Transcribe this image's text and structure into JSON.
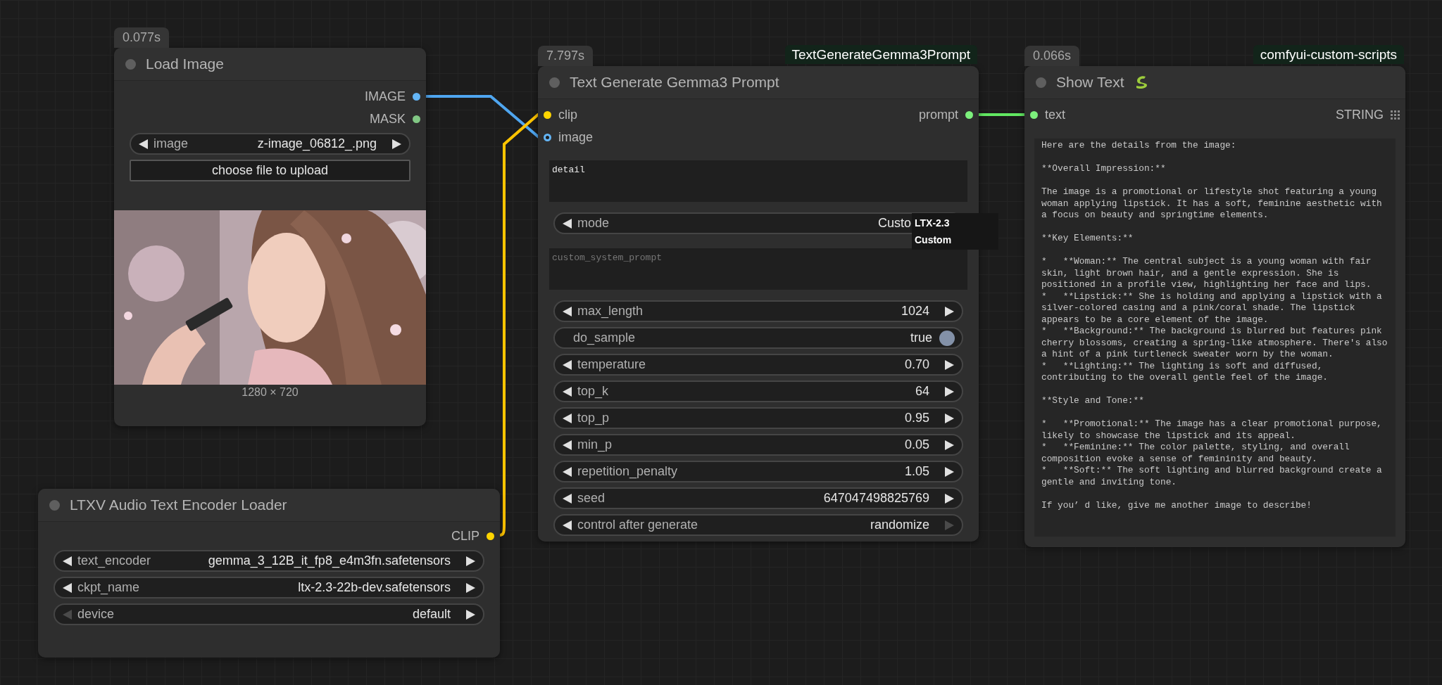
{
  "nodes": [
    {
      "title": "Load Image",
      "timing": "0.077s",
      "outputs": [
        {
          "label": "IMAGE",
          "kind": "dot",
          "color": "#64b5f6"
        },
        {
          "label": "MASK",
          "kind": "dot",
          "color": "#81c784"
        }
      ],
      "widgets": [
        {
          "kind": "combo",
          "label": "image",
          "value": "z-image_06812_.png",
          "prev_disabled": false,
          "next_disabled": false
        },
        {
          "kind": "button",
          "label": "choose file to upload"
        }
      ],
      "preview": {
        "kind": "picture",
        "caption": "1280 × 720"
      }
    },
    {
      "title": "Text Generate Gemma3 Prompt",
      "timing": "7.797s",
      "class_badge": "TextGenerateGemma3Prompt",
      "inputs": [
        {
          "label": "clip",
          "kind": "dot",
          "color": "#ffd500",
          "hollow": false
        },
        {
          "label": "image",
          "kind": "dot",
          "color": "#64b5f6",
          "hollow": true
        }
      ],
      "outputs": [
        {
          "label": "prompt",
          "kind": "dot",
          "color": "#7cf07c"
        }
      ],
      "widgets": [
        {
          "kind": "textarea",
          "value": "detail"
        },
        {
          "kind": "combo",
          "label": "mode",
          "value": "Custo",
          "prev_disabled": false,
          "menu": [
            "LTX-2.3",
            "Custom"
          ]
        },
        {
          "kind": "textarea",
          "placeholder": "custom_system_prompt"
        },
        {
          "kind": "number",
          "label": "max_length",
          "value": "1024",
          "prev_disabled": false,
          "next_disabled": false
        },
        {
          "kind": "toggle",
          "label": "do_sample",
          "value": "true",
          "on": true
        },
        {
          "kind": "number",
          "label": "temperature",
          "value": "0.70",
          "prev_disabled": false,
          "next_disabled": false
        },
        {
          "kind": "number",
          "label": "top_k",
          "value": "64",
          "prev_disabled": false,
          "next_disabled": false
        },
        {
          "kind": "number",
          "label": "top_p",
          "value": "0.95",
          "prev_disabled": false,
          "next_disabled": false
        },
        {
          "kind": "number",
          "label": "min_p",
          "value": "0.05",
          "prev_disabled": false,
          "next_disabled": false
        },
        {
          "kind": "number",
          "label": "repetition_penalty",
          "value": "1.05",
          "prev_disabled": false,
          "next_disabled": false
        },
        {
          "kind": "number",
          "label": "seed",
          "value": "647047498825769",
          "prev_disabled": false,
          "next_disabled": false
        },
        {
          "kind": "combo",
          "label": "control after generate",
          "value": "randomize",
          "prev_disabled": false,
          "next_disabled": true
        }
      ]
    },
    {
      "title": "Show Text",
      "timing": "0.066s",
      "class_badge": "comfyui-custom-scripts",
      "inputs": [
        {
          "label": "text",
          "kind": "dot",
          "color": "#7cf07c",
          "hollow": false
        }
      ],
      "outputs": [
        {
          "label": "STRING",
          "kind": "list"
        }
      ],
      "widgets": [
        {
          "kind": "output",
          "value": "Here are the details from the image:\n\n**Overall Impression:**\n\nThe image is a promotional or lifestyle shot featuring a young\nwoman applying lipstick. It has a soft, feminine aesthetic with\na focus on beauty and springtime elements.\n\n**Key Elements:**\n\n*   **Woman:** The central subject is a young woman with fair\nskin, light brown hair, and a gentle expression. She is\npositioned in a profile view, highlighting her face and lips.\n*   **Lipstick:** She is holding and applying a lipstick with a\nsilver-colored casing and a pink/coral shade. The lipstick\nappears to be a core element of the image.\n*   **Background:** The background is blurred but features pink\ncherry blossoms, creating a spring-like atmosphere. There's also\na hint of a pink turtleneck sweater worn by the woman.\n*   **Lighting:** The lighting is soft and diffused,\ncontributing to the overall gentle feel of the image.\n\n**Style and Tone:**\n\n*   **Promotional:** The image has a clear promotional purpose,\nlikely to showcase the lipstick and its appeal.\n*   **Feminine:** The color palette, styling, and overall\ncomposition evoke a sense of femininity and beauty.\n*   **Soft:** The soft lighting and blurred background create a\ngentle and inviting tone.\n\nIf you’ d like, give me another image to describe!"
        }
      ]
    },
    {
      "title": "LTXV Audio Text Encoder Loader",
      "outputs": [
        {
          "label": "CLIP",
          "kind": "dot",
          "color": "#ffd500"
        }
      ],
      "widgets": [
        {
          "kind": "combo",
          "label": "text_encoder",
          "value": "gemma_3_12B_it_fp8_e4m3fn.safetensors",
          "prev_disabled": false,
          "next_disabled": false
        },
        {
          "kind": "combo",
          "label": "ckpt_name",
          "value": "ltx-2.3-22b-dev.safetensors",
          "prev_disabled": false,
          "next_disabled": false
        },
        {
          "kind": "combo",
          "label": "device",
          "value": "default",
          "prev_disabled": true,
          "next_disabled": false
        }
      ]
    }
  ]
}
